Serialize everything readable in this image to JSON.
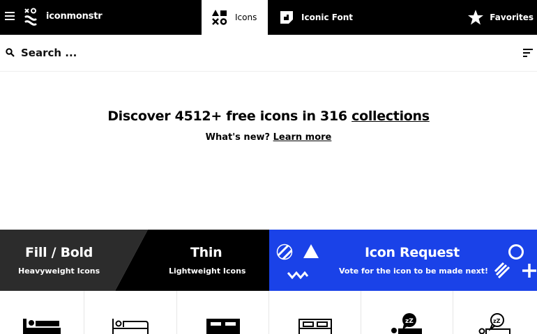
{
  "nav": {
    "brand": "iconmonstr",
    "tabs": [
      {
        "label": "Icons",
        "icon": "shapes-icon",
        "active": true
      },
      {
        "label": "Iconic Font",
        "icon": "font-icon",
        "active": false
      }
    ],
    "favorites_label": "Favorites"
  },
  "search": {
    "placeholder": "Search ..."
  },
  "hero": {
    "title_prefix": "Discover 4512+ free icons in 316 ",
    "title_link": "collections",
    "sub_prefix": "What's new? ",
    "sub_link": "Learn more"
  },
  "bands": [
    {
      "title": "Fill / Bold",
      "subtitle": "Heavyweight Icons",
      "color": "#2c2c2c"
    },
    {
      "title": "Thin",
      "subtitle": "Lightweight Icons",
      "color": "#000000"
    },
    {
      "title": "Icon Request",
      "subtitle": "Vote for the icon to be made next!",
      "color": "#1a42e8"
    }
  ],
  "grid_icons": [
    "bed-fill-icon",
    "bed-thin-icon",
    "double-bed-fill-icon",
    "double-bed-thin-icon",
    "sleep-zz-fill-icon",
    "sleep-zz-thin-icon"
  ],
  "colors": {
    "topbar": "#000000",
    "accent": "#1a42e8"
  }
}
